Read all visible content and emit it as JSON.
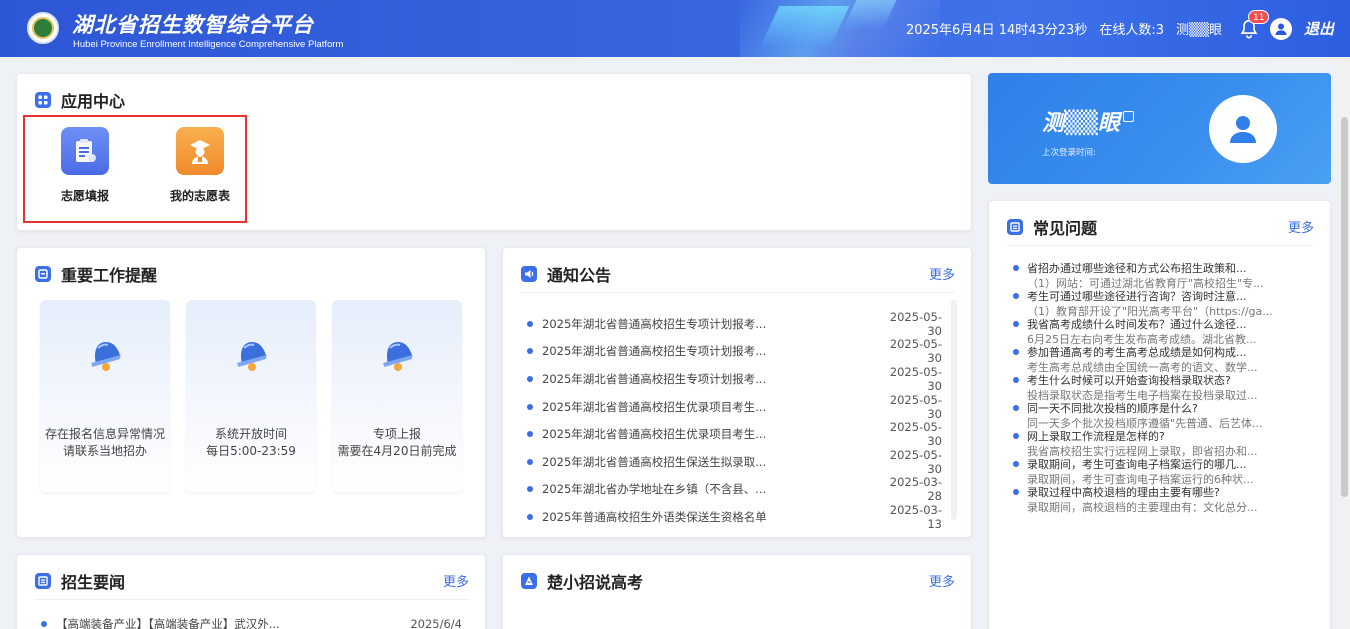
{
  "header": {
    "title_cn": "湖北省招生数智综合平台",
    "title_en": "Hubei Province Enrollment Intelligence Comprehensive Platform",
    "datetime": "2025年6月4日 14时43分23秒",
    "online": "在线人数:3",
    "user": "测▒▒眼",
    "badge": "11",
    "logout": "退出"
  },
  "app_center": {
    "title": "应用中心",
    "apps": [
      {
        "label": "志愿填报",
        "icon": "clipboard-icon",
        "color": "#4d72ea"
      },
      {
        "label": "我的志愿表",
        "icon": "graduate-icon",
        "color": "#f3993c"
      }
    ]
  },
  "reminders": {
    "title": "重要工作提醒",
    "items": [
      {
        "line1": "存在报名信息异常情况",
        "line2": "请联系当地招办"
      },
      {
        "line1": "系统开放时间",
        "line2": "每日5:00-23:59"
      },
      {
        "line1": "专项上报",
        "line2": "需要在4月20日前完成"
      }
    ]
  },
  "notices": {
    "title": "通知公告",
    "more": "更多",
    "items": [
      {
        "text": "2025年湖北省普通高校招生专项计划报考...",
        "date": "2025-05-30"
      },
      {
        "text": "2025年湖北省普通高校招生专项计划报考...",
        "date": "2025-05-30"
      },
      {
        "text": "2025年湖北省普通高校招生专项计划报考...",
        "date": "2025-05-30"
      },
      {
        "text": "2025年湖北省普通高校招生优录项目考生...",
        "date": "2025-05-30"
      },
      {
        "text": "2025年湖北省普通高校招生优录项目考生...",
        "date": "2025-05-30"
      },
      {
        "text": "2025年湖北省普通高校招生保送生拟录取...",
        "date": "2025-05-30"
      },
      {
        "text": "2025年湖北省办学地址在乡镇（不含县、...",
        "date": "2025-03-28"
      },
      {
        "text": "2025年普通高校招生外语类保送生资格名单",
        "date": "2025-03-13"
      }
    ]
  },
  "news": {
    "title": "招生要闻",
    "more": "更多",
    "items": [
      {
        "text": "【高端装备产业】【高端装备产业】武汉外...",
        "date": "2025/6/4"
      }
    ]
  },
  "chuxiaozhao": {
    "title": "楚小招说高考",
    "more": "更多"
  },
  "profile": {
    "name": "测▒▒眼",
    "last_login": "上次登录时间:"
  },
  "faq": {
    "title": "常见问题",
    "more": "更多",
    "items": [
      {
        "q": "省招办通过哪些途径和方式公布招生政策和...",
        "a": "（1）网站：可通过湖北省教育厅\"高校招生\"专..."
      },
      {
        "q": "考生可通过哪些途径进行咨询？咨询时注意...",
        "a": "（1）教育部开设了\"阳光高考平台\"（https://ga..."
      },
      {
        "q": "我省高考成绩什么时间发布？通过什么途径...",
        "a": "6月25日左右向考生发布高考成绩。湖北省教..."
      },
      {
        "q": "参加普通高考的考生高考总成绩是如何构成...",
        "a": "考生高考总成绩由全国统一高考的语文、数学..."
      },
      {
        "q": "考生什么时候可以开始查询投档录取状态?",
        "a": "投档录取状态是指考生电子档案在投档录取过..."
      },
      {
        "q": "同一天不同批次投档的顺序是什么?",
        "a": "同一天多个批次投档顺序遵循\"先普通、后艺体..."
      },
      {
        "q": "网上录取工作流程是怎样的?",
        "a": "我省高校招生实行远程网上录取，即省招办和..."
      },
      {
        "q": "录取期间，考生可查询电子档案运行的哪几...",
        "a": "录取期间，考生可查询电子档案运行的6种状..."
      },
      {
        "q": "录取过程中高校退档的理由主要有哪些?",
        "a": "录取期间，高校退档的主要理由有：文化总分..."
      }
    ]
  }
}
